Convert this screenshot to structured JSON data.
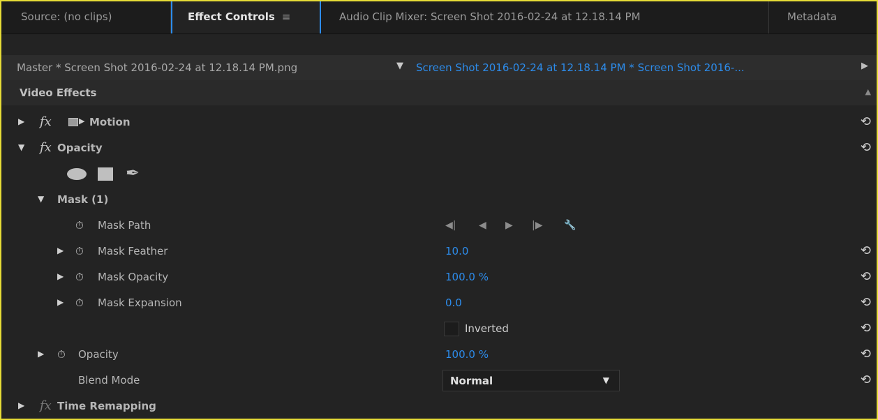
{
  "tabs": [
    {
      "label": "Source: (no clips)"
    },
    {
      "label": "Effect Controls",
      "menu": "≡"
    },
    {
      "label": "Audio Clip Mixer: Screen Shot 2016-02-24 at 12.18.14 PM"
    },
    {
      "label": "Metadata"
    }
  ],
  "header": {
    "master": "Master * Screen Shot 2016-02-24 at 12.18.14 PM.png",
    "clip": "Screen Shot 2016-02-24 at 12.18.14 PM * Screen Shot 2016-..."
  },
  "section_title": "Video Effects",
  "effects": {
    "motion": {
      "label": "Motion"
    },
    "opacity": {
      "label": "Opacity"
    },
    "time_remapping": {
      "label": "Time Remapping"
    }
  },
  "mask": {
    "label": "Mask (1)",
    "path_label": "Mask Path",
    "feather_label": "Mask Feather",
    "feather_value": "10.0",
    "opacity_label": "Mask Opacity",
    "opacity_value": "100.0 %",
    "expansion_label": "Mask Expansion",
    "expansion_value": "0.0",
    "inverted_label": "Inverted",
    "inverted_checked": false
  },
  "opacity_param": {
    "label": "Opacity",
    "value": "100.0 %"
  },
  "blend_mode": {
    "label": "Blend Mode",
    "value": "Normal"
  },
  "colors": {
    "accent": "#2d8ceb",
    "highlight_border": "#e6dc37",
    "panel_bg": "#232323"
  }
}
